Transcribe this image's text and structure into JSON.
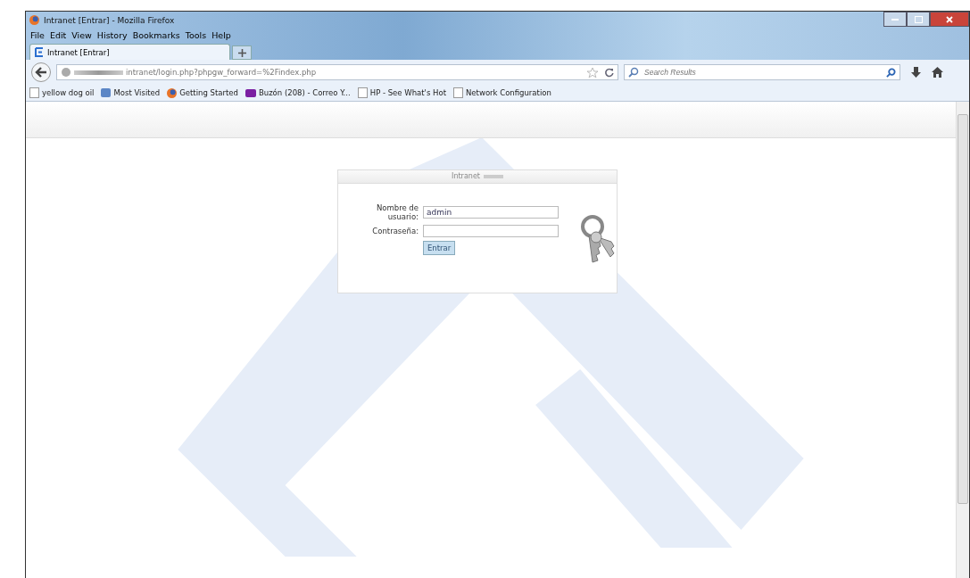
{
  "window": {
    "title": "Intranet [Entrar] - Mozilla Firefox"
  },
  "menu": [
    "File",
    "Edit",
    "View",
    "History",
    "Bookmarks",
    "Tools",
    "Help"
  ],
  "tabs": [
    {
      "label": "Intranet [Entrar]",
      "selected": true
    }
  ],
  "address": {
    "value": "intranet/login.php?phpgw_forward=%2Findex.php"
  },
  "search": {
    "placeholder": "Search Results"
  },
  "bookmarks": [
    {
      "label": "yellow dog oil",
      "kind": "page"
    },
    {
      "label": "Most Visited",
      "kind": "folder"
    },
    {
      "label": "Getting Started",
      "kind": "firefox"
    },
    {
      "label": "Buzón (208) - Correo Y...",
      "kind": "yahoo"
    },
    {
      "label": "HP - See What's Hot",
      "kind": "page"
    },
    {
      "label": "Network Configuration",
      "kind": "page"
    }
  ],
  "login": {
    "title": "Intranet",
    "username_label": "Nombre de usuario:",
    "username": "admin",
    "password_label": "Contraseña:",
    "submit": "Entrar"
  }
}
